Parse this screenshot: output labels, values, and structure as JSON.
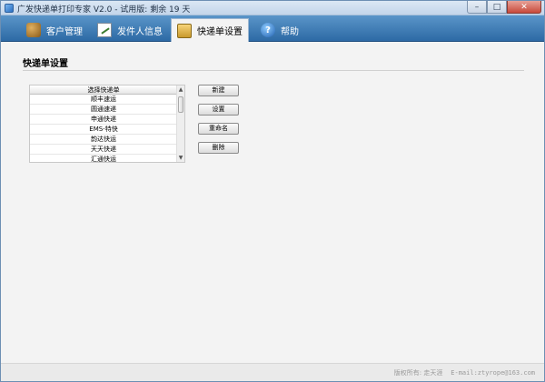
{
  "window": {
    "title": "广发快递单打印专家 V2.0 - 试用版: 剩余 19 天",
    "controls": {
      "minimize": "–",
      "maximize": "□",
      "close": "✕"
    }
  },
  "tabs": [
    {
      "label": "客户管理",
      "icon": "customer-icon",
      "active": false
    },
    {
      "label": "发件人信息",
      "icon": "sender-info-icon",
      "active": false
    },
    {
      "label": "快递单设置",
      "icon": "express-form-icon",
      "active": true
    },
    {
      "label": "帮助",
      "icon": "help-icon",
      "active": false
    }
  ],
  "main": {
    "section_title": "快递单设置",
    "list": {
      "header": "选择快递单",
      "items": [
        "顺丰速运",
        "圆通速递",
        "申通快递",
        "EMS-特快",
        "韵达快运",
        "天天快递",
        "汇通快运"
      ]
    },
    "buttons": {
      "new": "新建",
      "settings": "设置",
      "rename": "重命名",
      "delete": "删除"
    }
  },
  "statusbar": {
    "copyright": "版权所有: 走天涯",
    "email": "E-mail:ztyrope@163.com"
  }
}
